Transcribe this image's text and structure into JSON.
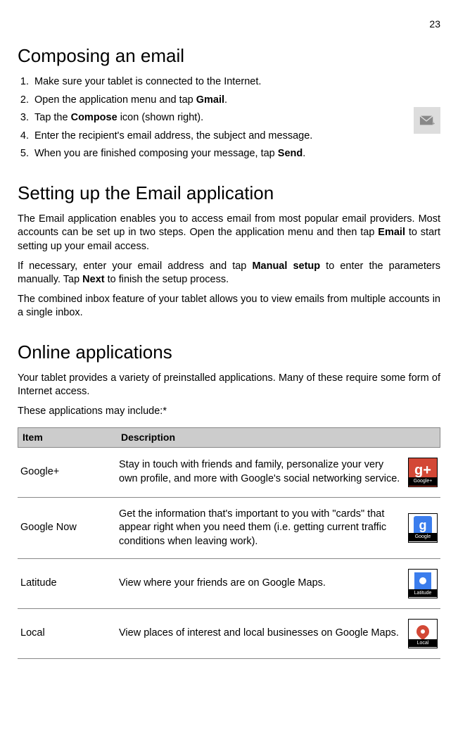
{
  "page_number": "23",
  "section1": {
    "title": "Composing an email",
    "steps": [
      "Make sure your tablet is connected to the Internet.",
      "Open the application menu and tap ",
      "Tap the ",
      "Enter the recipient's email address, the subject and message.",
      "When you are finished composing your message, tap "
    ],
    "bold_words": {
      "gmail": "Gmail",
      "compose": "Compose",
      "send": "Send"
    },
    "step2_suffix": ".",
    "step3_suffix": " icon (shown right).",
    "step5_suffix": "."
  },
  "section2": {
    "title": "Setting up the Email application",
    "para1_a": "The Email application enables you to access email from most popular email providers. Most accounts can be set up in two steps. Open the application menu and then tap ",
    "para1_bold": "Email",
    "para1_b": " to start setting up your email access.",
    "para2_a": "If necessary, enter your email address and tap ",
    "para2_bold1": "Manual setup",
    "para2_b": " to enter the parameters manually. Tap ",
    "para2_bold2": "Next",
    "para2_c": " to finish the setup process.",
    "para3": "The combined inbox feature of your tablet allows you to view emails from multiple accounts in a single inbox."
  },
  "section3": {
    "title": "Online applications",
    "para1": "Your tablet provides a variety of preinstalled applications. Many of these require some form of Internet access.",
    "para2": "These applications may include:*"
  },
  "table": {
    "headers": {
      "item": "Item",
      "description": "Description"
    },
    "rows": [
      {
        "item": "Google+",
        "description": "Stay in touch with friends and family, personalize your very own profile, and more with Google's social networking service.",
        "icon_label": "Google+"
      },
      {
        "item": "Google Now",
        "description": "Get the information that's important to you with \"cards\" that appear right when you need them (i.e. getting current traffic conditions when leaving work).",
        "icon_label": "Google"
      },
      {
        "item": "Latitude",
        "description": "View where your friends are on Google Maps.",
        "icon_label": "Latitude"
      },
      {
        "item": "Local",
        "description": "View places of interest and local businesses on Google Maps.",
        "icon_label": "Local"
      }
    ]
  }
}
